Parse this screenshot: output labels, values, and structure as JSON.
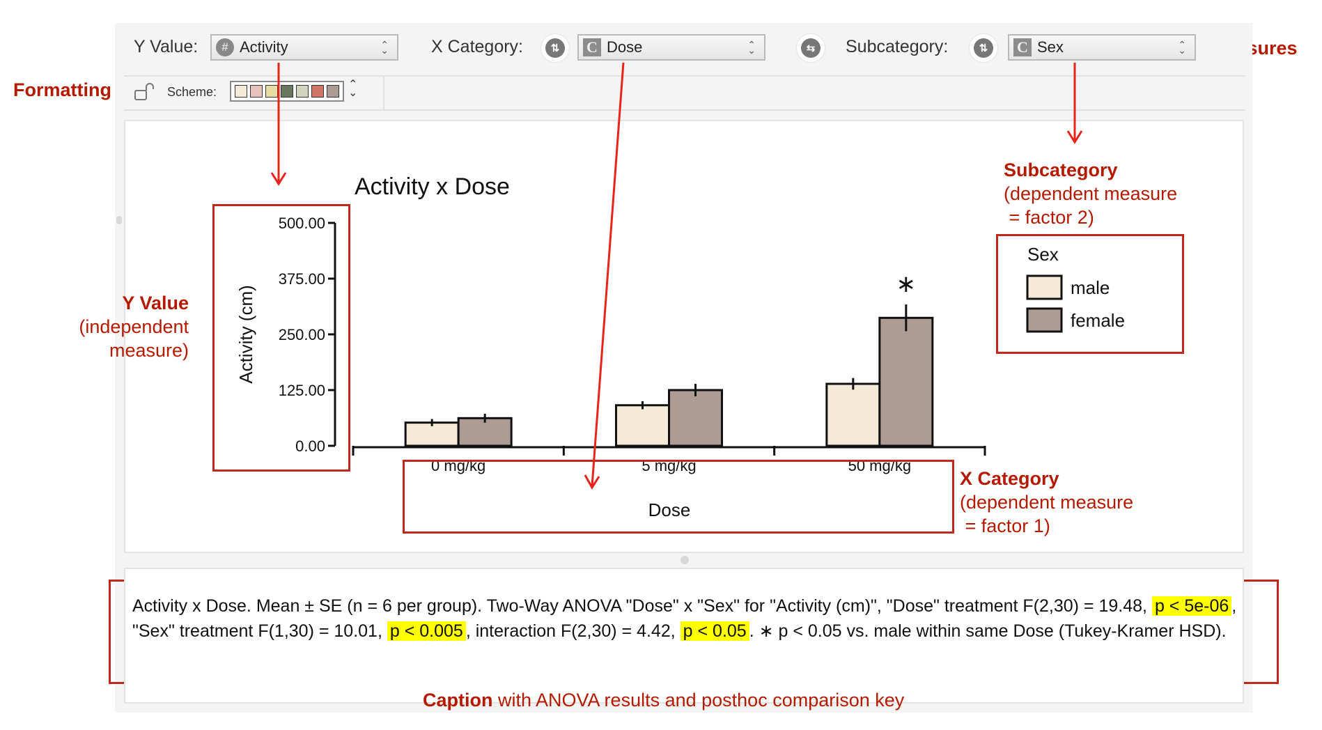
{
  "toolbar": {
    "y_value_label": "Y Value:",
    "y_value_selected": "Activity",
    "y_value_icon": "numeric-hash-icon",
    "x_category_label": "X Category:",
    "x_category_selected": "Dose",
    "x_category_icon": "categorical-c-icon",
    "subcategory_label": "Subcategory:",
    "subcategory_selected": "Sex",
    "subcategory_icon": "categorical-c-icon",
    "sort_toggle_icon": "sort-arrows-icon",
    "swap_icon": "swap-arrows-icon"
  },
  "formatting": {
    "lock_icon": "unlock-icon",
    "scheme_label": "Scheme:",
    "scheme_colors": [
      "#f4ead7",
      "#e6c3bb",
      "#e8dca3",
      "#69785f",
      "#d3d4bf",
      "#cf7565",
      "#ad9c94"
    ]
  },
  "annotations": {
    "measures": "Measures",
    "formatting": "Formatting",
    "y_value_title": "Y Value",
    "y_value_line1": "(independent",
    "y_value_line2": "measure)",
    "subcategory_title": "Subcategory",
    "subcategory_line1": "(dependent measure",
    "subcategory_line2": " = factor 2)",
    "x_category_title": "X Category",
    "x_category_line1": "(dependent measure",
    "x_category_line2": " = factor 1)",
    "caption_title": "Caption",
    "caption_rest": " with ANOVA results and posthoc comparison key"
  },
  "caption": {
    "part1": "Activity x Dose.  Mean ± SE (n = 6 per group). Two-Way ANOVA \"Dose\" x \"Sex\" for \"Activity (cm)\", \"Dose\" treatment F(2,30) = 19.48, ",
    "p1": "p < 5e-06",
    "part2": ", \"Sex\" treatment F(1,30) = 10.01, ",
    "p2": "p < 0.005",
    "part3": ", interaction F(2,30) = 4.42, ",
    "p3": "p < 0.05",
    "part4": ". ∗ p < 0.05 vs. male within same Dose (Tukey-Kramer HSD)."
  },
  "chart_data": {
    "type": "bar",
    "title": "Activity x Dose",
    "xlabel": "Dose",
    "ylabel": "Activity (cm)",
    "ylim": [
      0,
      500
    ],
    "yticks": [
      "0.00",
      "125.00",
      "250.00",
      "375.00",
      "500.00"
    ],
    "ytick_values": [
      0,
      125,
      250,
      375,
      500
    ],
    "categories": [
      "0 mg/kg",
      "5 mg/kg",
      "50 mg/kg"
    ],
    "legend_title": "Sex",
    "legend_position": "right",
    "series": [
      {
        "name": "male",
        "color": "#f4ead7",
        "values": [
          52,
          91,
          139
        ],
        "errors": [
          8,
          9,
          13
        ]
      },
      {
        "name": "female",
        "color": "#ad9c94",
        "values": [
          62,
          125,
          287
        ],
        "errors": [
          10,
          14,
          30
        ]
      }
    ],
    "significance": [
      {
        "category": "50 mg/kg",
        "series": "female",
        "marker": "*"
      }
    ],
    "grid": false
  }
}
